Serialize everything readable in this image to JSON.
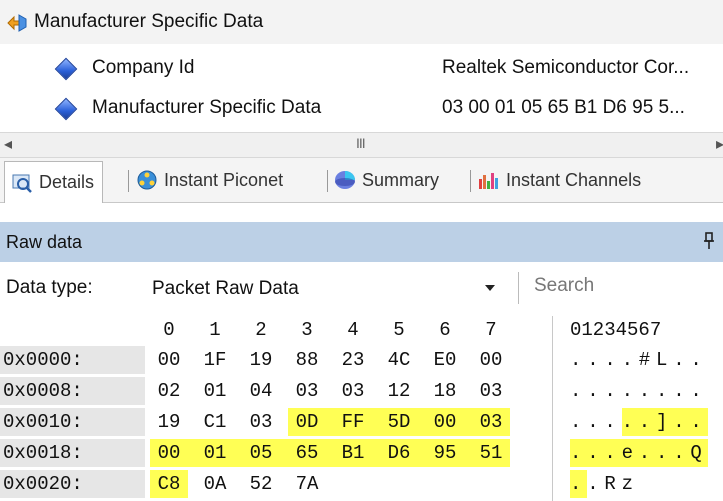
{
  "tree": {
    "parent_label": "Manufacturer Specific Data",
    "children": [
      {
        "label": "Company Id",
        "value": "Realtek Semiconductor Cor..."
      },
      {
        "label": "Manufacturer Specific Data",
        "value": "03 00 01 05 65 B1 D6 95 5..."
      }
    ]
  },
  "scrollbar": {
    "left_arrow": "◂",
    "right_arrow": "▸",
    "grip": "III"
  },
  "tabs": [
    {
      "label": "Details",
      "active": true,
      "icon": "details-icon"
    },
    {
      "label": "Instant Piconet",
      "active": false,
      "icon": "piconet-icon"
    },
    {
      "label": "Summary",
      "active": false,
      "icon": "summary-icon"
    },
    {
      "label": "Instant Channels",
      "active": false,
      "icon": "channels-icon"
    }
  ],
  "raw_panel": {
    "title": "Raw data",
    "pin_glyph": "ᵽ"
  },
  "data_type": {
    "label": "Data type:",
    "selected": "Packet Raw Data",
    "search_placeholder": "Search"
  },
  "hex": {
    "columns": [
      "0",
      "1",
      "2",
      "3",
      "4",
      "5",
      "6",
      "7"
    ],
    "ascii_header": "01234567",
    "highlight_color": "#ffff55",
    "rows": [
      {
        "addr": "0x0000:",
        "bytes": [
          "00",
          "1F",
          "19",
          "88",
          "23",
          "4C",
          "E0",
          "00"
        ],
        "hl": [
          false,
          false,
          false,
          false,
          false,
          false,
          false,
          false
        ],
        "ascii": "....#L.."
      },
      {
        "addr": "0x0008:",
        "bytes": [
          "02",
          "01",
          "04",
          "03",
          "03",
          "12",
          "18",
          "03"
        ],
        "hl": [
          false,
          false,
          false,
          false,
          false,
          false,
          false,
          false
        ],
        "ascii": "........"
      },
      {
        "addr": "0x0010:",
        "bytes": [
          "19",
          "C1",
          "03",
          "0D",
          "FF",
          "5D",
          "00",
          "03"
        ],
        "hl": [
          false,
          false,
          false,
          true,
          true,
          true,
          true,
          true
        ],
        "ascii": ".....]..",
        "ascii_hl_from": 3
      },
      {
        "addr": "0x0018:",
        "bytes": [
          "00",
          "01",
          "05",
          "65",
          "B1",
          "D6",
          "95",
          "51"
        ],
        "hl": [
          true,
          true,
          true,
          true,
          true,
          true,
          true,
          true
        ],
        "ascii": "...e...Q",
        "ascii_hl_from": 0
      },
      {
        "addr": "0x0020:",
        "bytes": [
          "C8",
          "0A",
          "52",
          "7A"
        ],
        "hl": [
          true,
          false,
          false,
          false
        ],
        "ascii": "..Rz",
        "ascii_hl_from": 0,
        "ascii_hl_to": 1
      }
    ]
  }
}
